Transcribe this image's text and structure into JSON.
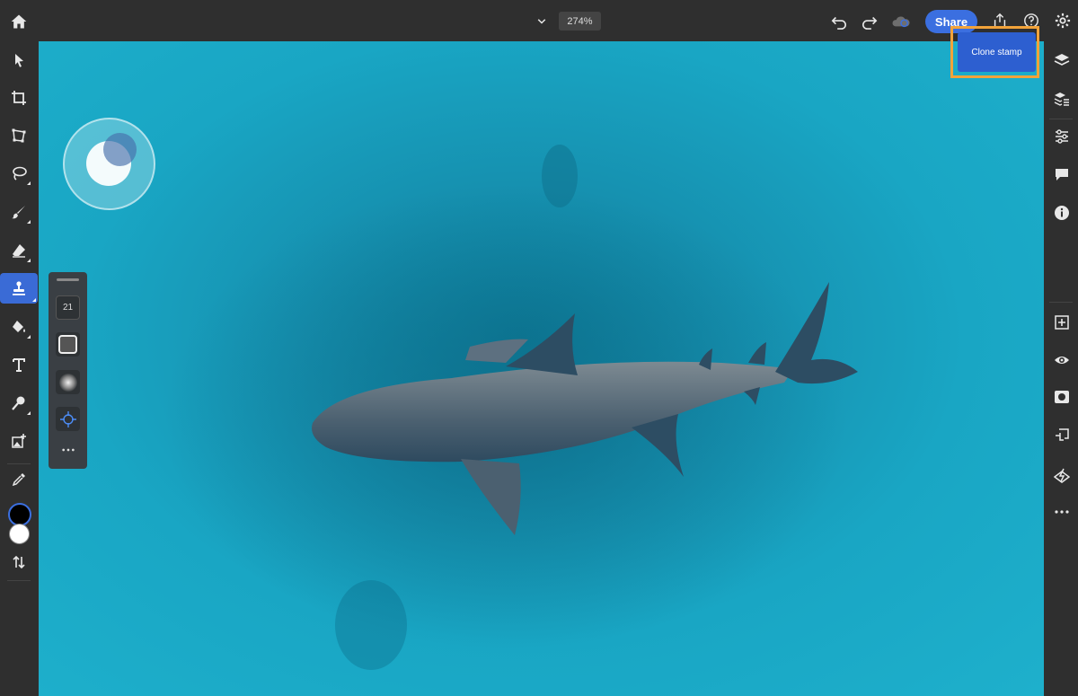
{
  "topbar": {
    "zoom_level": "274%",
    "share_label": "Share"
  },
  "tooltip": {
    "label": "Clone stamp"
  },
  "tool_options": {
    "brush_size": "21"
  },
  "left_tools": [
    "select-icon",
    "crop-icon",
    "transform-icon",
    "lasso-icon",
    "brush-icon",
    "eraser-icon",
    "clone-stamp-icon",
    "paint-bucket-icon",
    "type-icon",
    "healing-icon",
    "place-image-icon",
    "eyedropper-icon"
  ],
  "right_tools": [
    "layers-icon",
    "layer-properties-icon",
    "adjustments-icon",
    "comments-icon",
    "info-icon",
    "add-layer-icon",
    "visibility-icon",
    "mask-icon",
    "clipping-icon",
    "fx-icon",
    "more-icon"
  ],
  "colors": {
    "accent": "#3b6fe0",
    "highlight": "#f2a33a",
    "foreground": "#000000",
    "background": "#ffffff"
  }
}
